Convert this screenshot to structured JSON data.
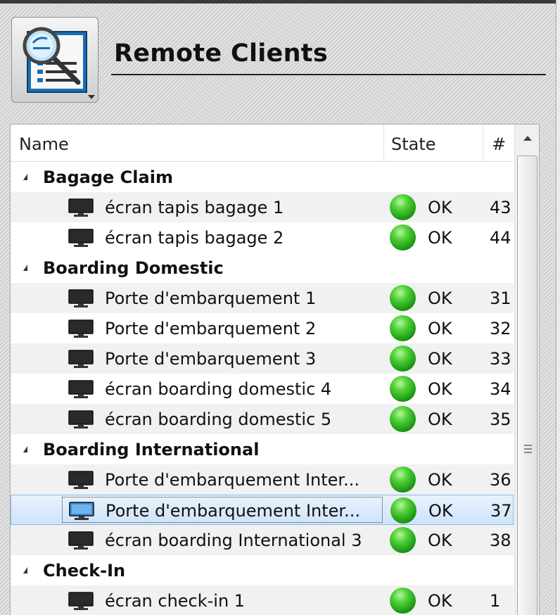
{
  "panel": {
    "title": "Remote Clients"
  },
  "columns": {
    "name": "Name",
    "state": "State",
    "number": "#"
  },
  "groups": [
    {
      "label": "Bagage Claim",
      "clients": [
        {
          "name": "écran tapis bagage 1",
          "state": "OK",
          "number": "43"
        },
        {
          "name": "écran tapis bagage 2",
          "state": "OK",
          "number": "44"
        }
      ]
    },
    {
      "label": "Boarding Domestic",
      "clients": [
        {
          "name": "Porte d'embarquement 1",
          "state": "OK",
          "number": "31"
        },
        {
          "name": "Porte d'embarquement 2",
          "state": "OK",
          "number": "32"
        },
        {
          "name": "Porte d'embarquement 3",
          "state": "OK",
          "number": "33"
        },
        {
          "name": "écran boarding domestic 4",
          "state": "OK",
          "number": "34"
        },
        {
          "name": "écran boarding domestic 5",
          "state": "OK",
          "number": "35"
        }
      ]
    },
    {
      "label": "Boarding International",
      "clients": [
        {
          "name": "Porte d'embarquement Inter...",
          "state": "OK",
          "number": "36"
        },
        {
          "name": "Porte d'embarquement Inter...",
          "state": "OK",
          "number": "37",
          "selected": true
        },
        {
          "name": "écran boarding International 3",
          "state": "OK",
          "number": "38"
        }
      ]
    },
    {
      "label": "Check-In",
      "clients": [
        {
          "name": "écran check-in 1",
          "state": "OK",
          "number": "1"
        }
      ]
    }
  ],
  "colors": {
    "status_ok": "#2fb81f",
    "selection": "#cfe3fa"
  },
  "icons": {
    "header": "remote-clients-list-magnifier-icon",
    "client": "monitor-icon",
    "status": "green-status-dot-icon"
  }
}
